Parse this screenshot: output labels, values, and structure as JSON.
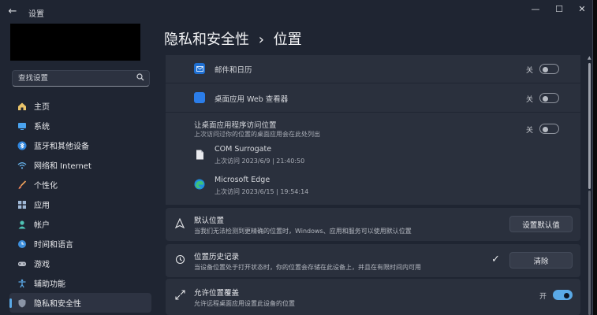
{
  "window": {
    "app_title": "设置",
    "back_icon": "back-arrow-icon",
    "min": "—",
    "max": "☐",
    "close": "✕"
  },
  "search": {
    "placeholder": "查找设置",
    "icon": "search-icon"
  },
  "sidebar": {
    "items": [
      {
        "label": "主页",
        "icon": "home-icon"
      },
      {
        "label": "系统",
        "icon": "monitor-icon"
      },
      {
        "label": "蓝牙和其他设备",
        "icon": "bluetooth-icon"
      },
      {
        "label": "网络和 Internet",
        "icon": "wifi-icon"
      },
      {
        "label": "个性化",
        "icon": "brush-icon"
      },
      {
        "label": "应用",
        "icon": "apps-icon"
      },
      {
        "label": "帐户",
        "icon": "account-icon"
      },
      {
        "label": "时间和语言",
        "icon": "globe-clock-icon"
      },
      {
        "label": "游戏",
        "icon": "gamepad-icon"
      },
      {
        "label": "辅助功能",
        "icon": "accessibility-icon"
      },
      {
        "label": "隐私和安全性",
        "icon": "shield-icon",
        "active": true
      }
    ]
  },
  "breadcrumb": {
    "parent": "隐私和安全性",
    "separator": "›",
    "current": "位置"
  },
  "apps": [
    {
      "label": "邮件和日历",
      "state": "关",
      "on": false
    },
    {
      "label": "桌面应用 Web 查看器",
      "state": "关",
      "on": false
    }
  ],
  "desktop_access": {
    "label": "让桌面应用程序访问位置",
    "sub": "上次访问过你的位置的桌面应用会在此处列出",
    "state": "关",
    "on": false,
    "entries": [
      {
        "name": "COM Surrogate",
        "last": "上次访问 2023/6/9 | 21:40:50",
        "icon": "file-icon"
      },
      {
        "name": "Microsoft Edge",
        "last": "上次访问 2023/6/15 | 19:54:14",
        "icon": "edge-icon"
      }
    ]
  },
  "default_location": {
    "title": "默认位置",
    "desc": "当我们无法检测到更精确的位置时，Windows、应用和服务可以使用默认位置",
    "button": "设置默认值",
    "icon": "location-pin-icon"
  },
  "location_history": {
    "title": "位置历史记录",
    "desc": "当设备位置处于打开状态时，你的位置会存储在此设备上，并且在有限时间内可用",
    "button": "清除",
    "check": "✓",
    "icon": "history-icon"
  },
  "override": {
    "title": "允许位置覆盖",
    "desc": "允许远程桌面应用设置此设备的位置",
    "state": "开",
    "on": true,
    "icon": "override-arrows-icon"
  },
  "colors": {
    "accent": "#5aa9e6",
    "mail_icon": "#1f6fd1",
    "webview_icon": "#2b7de9"
  }
}
